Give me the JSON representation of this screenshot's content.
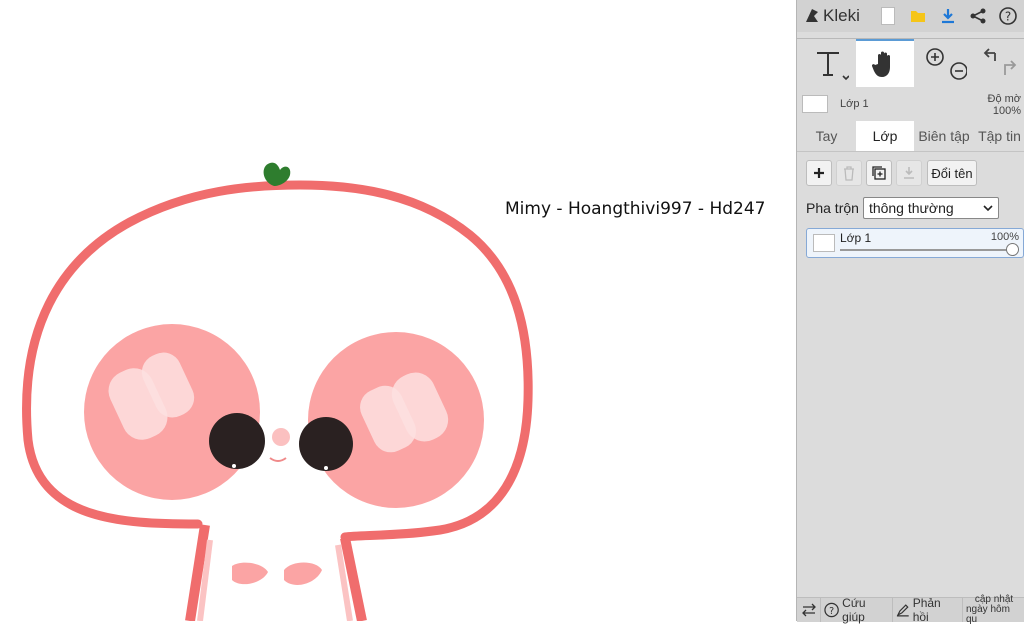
{
  "canvas": {
    "watermark_text": "Mimy - Hoangthivi997 - Hd247"
  },
  "app": {
    "name": "Kleki"
  },
  "layer_info": {
    "name": "Lớp 1",
    "opacity_label": "Độ mờ",
    "opacity_value": "100%"
  },
  "tabs": [
    {
      "label": "Tay"
    },
    {
      "label": "Lớp"
    },
    {
      "label": "Biên tập"
    },
    {
      "label": "Tập tin"
    }
  ],
  "layers_panel": {
    "rename_label": "Đổi tên",
    "blend_label": "Pha trộn",
    "blend_value": "thông thường",
    "layers": [
      {
        "name": "Lớp 1",
        "opacity": "100%",
        "opacity_fraction": 1.0
      }
    ]
  },
  "bottom_bar": {
    "help_label": "Cứu giúp",
    "feedback_label": "Phản hồi",
    "update_label_line1": "cập nhật",
    "update_label_line2": "ngày hôm qu"
  },
  "colors": {
    "sidebar_bg": "#dcdcdc",
    "accent": "#5b9bd5",
    "drawing_outline": "#f06d6d",
    "cheek": "#fba4a4",
    "eye": "#2a2121"
  }
}
